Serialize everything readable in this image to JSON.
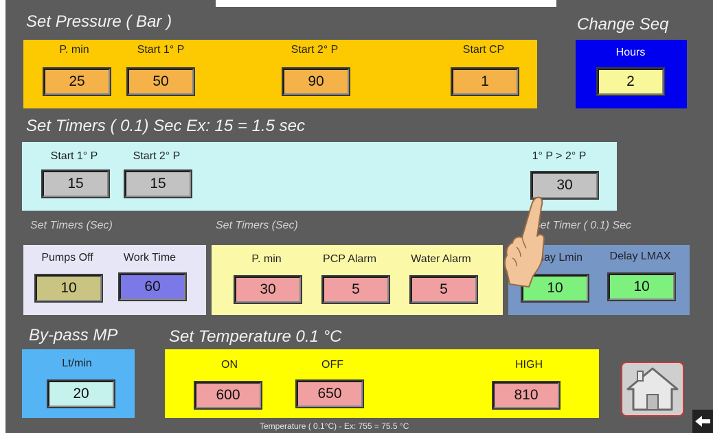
{
  "pressure": {
    "title": "Set Pressure ( Bar )",
    "pmin": {
      "label": "P. min",
      "value": "25"
    },
    "start1": {
      "label": "Start  1° P",
      "value": "50"
    },
    "start2": {
      "label": "Start 2° P",
      "value": "90"
    },
    "startcp": {
      "label": "Start CP",
      "value": "1"
    }
  },
  "change_seq": {
    "title": "Change Seq",
    "hours": {
      "label": "Hours",
      "value": "2"
    }
  },
  "timers_01": {
    "title": "Set Timers ( 0.1) Sec   Ex: 15 = 1.5 sec",
    "start1": {
      "label": "Start  1° P",
      "value": "15"
    },
    "start2": {
      "label": "Start 2° P",
      "value": "15"
    },
    "p1p2": {
      "label": "1° P > 2° P",
      "value": "30"
    }
  },
  "timers_sec_a": {
    "title": "Set Timers (Sec)",
    "pumps_off": {
      "label": "Pumps Off",
      "value": "10"
    },
    "work_time": {
      "label": "Work Time",
      "value": "60"
    }
  },
  "timers_sec_b": {
    "title": "Set Timers (Sec)",
    "pmin": {
      "label": "P. min",
      "value": "30"
    },
    "pcp_alarm": {
      "label": "PCP Alarm",
      "value": "5"
    },
    "water_alarm": {
      "label": "Water Alarm",
      "value": "5"
    }
  },
  "timer_01": {
    "title": "Set Timer ( 0.1) Sec",
    "delay_lmin": {
      "label": "Delay Lmin",
      "value": "10"
    },
    "delay_lmax": {
      "label": "Delay LMAX",
      "value": "10"
    }
  },
  "bypass": {
    "title": "By-pass MP",
    "ltmin": {
      "label": "Lt/min",
      "value": "20"
    }
  },
  "temperature": {
    "title": "Set Temperature  0.1 °C",
    "on": {
      "label": "ON",
      "value": "600"
    },
    "off": {
      "label": "OFF",
      "value": "650"
    },
    "high": {
      "label": "HIGH",
      "value": "810"
    }
  },
  "footer": "Temperature ( 0.1°C) - Ex: 755 = 75.5 °C",
  "icons": {
    "home": "home-icon",
    "back": "back-arrow-icon",
    "pointer": "pointing-hand-icon"
  }
}
